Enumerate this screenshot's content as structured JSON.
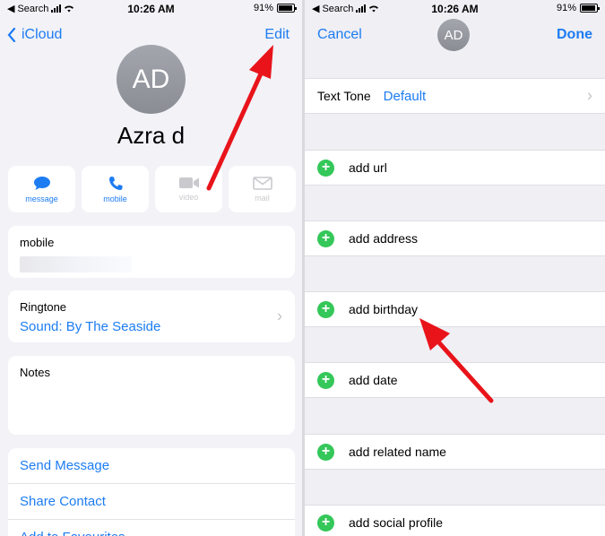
{
  "left_screen": {
    "status": {
      "carrier": "Search",
      "time": "10:26 AM",
      "battery": "91%",
      "battery_level": 0.91
    },
    "nav": {
      "back_label": "iCloud",
      "edit_label": "Edit"
    },
    "avatar_initials": "AD",
    "contact_name": "Azra d",
    "actions": [
      {
        "label": "message",
        "icon": "message-bubble-icon",
        "enabled": true
      },
      {
        "label": "mobile",
        "icon": "phone-icon",
        "enabled": true
      },
      {
        "label": "video",
        "icon": "video-camera-icon",
        "enabled": false
      },
      {
        "label": "mail",
        "icon": "envelope-icon",
        "enabled": false
      }
    ],
    "phone_field": {
      "label": "mobile"
    },
    "ringtone": {
      "label": "Ringtone",
      "value": "Sound: By The Seaside"
    },
    "notes": {
      "label": "Notes"
    },
    "links": [
      "Send Message",
      "Share Contact",
      "Add to Favourites"
    ]
  },
  "right_screen": {
    "status": {
      "carrier": "Search",
      "time": "10:26 AM",
      "battery": "91%",
      "battery_level": 0.91
    },
    "nav": {
      "cancel_label": "Cancel",
      "done_label": "Done"
    },
    "avatar_initials": "AD",
    "text_tone": {
      "label": "Text Tone",
      "value": "Default"
    },
    "add_rows": [
      "add url",
      "add address",
      "add birthday",
      "add date",
      "add related name",
      "add social profile"
    ]
  },
  "colors": {
    "ios_blue": "#1d7cf2",
    "add_green": "#34c759",
    "annotation_red": "#e8141a"
  }
}
